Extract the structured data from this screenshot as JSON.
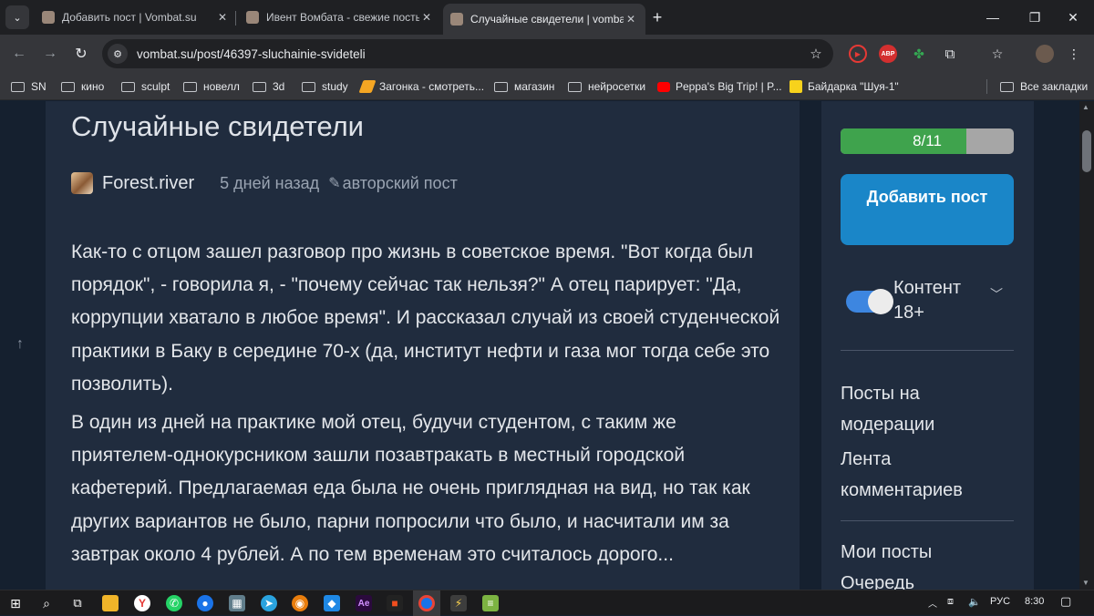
{
  "browser": {
    "tabs": [
      {
        "title": "Добавить пост | Vombat.su",
        "active": false
      },
      {
        "title": "Ивент Вомбата - свежие посты",
        "active": false
      },
      {
        "title": "Случайные свидетели | vombat",
        "active": true
      }
    ],
    "url": "vombat.su/post/46397-sluchainie-svideteli",
    "extension_abp_label": "ABP",
    "bookmarks": [
      {
        "label": "SN",
        "type": "folder"
      },
      {
        "label": "кино",
        "type": "folder"
      },
      {
        "label": "sculpt",
        "type": "folder"
      },
      {
        "label": "новелл",
        "type": "folder"
      },
      {
        "label": "3d",
        "type": "folder"
      },
      {
        "label": "study",
        "type": "folder"
      },
      {
        "label": "Загонка - смотреть...",
        "type": "site",
        "color": "#f5a623"
      },
      {
        "label": "магазин",
        "type": "folder"
      },
      {
        "label": "нейросетки",
        "type": "folder"
      },
      {
        "label": "Peppa's Big Trip! | P...",
        "type": "site",
        "color": "#ff0000"
      },
      {
        "label": "Байдарка \"Шуя-1\"",
        "type": "site",
        "color": "#f7d21c"
      }
    ],
    "all_bookmarks_label": "Все закладки"
  },
  "post": {
    "title": "Случайные свидетели",
    "author": "Forest.river",
    "time": "5 дней назад",
    "tag": "авторский пост",
    "paragraphs": [
      "Как-то с отцом зашел разговор про жизнь в советское время. \"Вот когда был порядок\", - говорила я, - \"почему сейчас так нельзя?\" А отец парирует: \"Да, коррупции хватало в любое время\". И рассказал случай из своей студенческой практики в Баку в середине 70-х (да, институт нефти и газа мог тогда себе это позволить).",
      "В один из дней на практике мой отец, будучи студентом, с таким же приятелем-однокурсником зашли позавтракать в местный городской кафетерий. Предлагаемая еда была не очень приглядная на вид, но так как других вариантов не было, парни попросили что было, и насчитали им за завтрак около 4 рублей. А по тем временам это считалось дорого..."
    ]
  },
  "sidebar": {
    "progress_label": "8/11",
    "progress_fraction": 0.727,
    "add_post_label": "Добавить пост",
    "content_toggle_label": "Контент 18+",
    "content_toggle_on": true,
    "links_group1": [
      "Посты на модерации",
      "Лента комментариев"
    ],
    "links_group2": [
      "Мои посты",
      "Очередь"
    ]
  },
  "taskbar": {
    "language": "РУС",
    "time": "8:30"
  },
  "colors": {
    "page_bg": "#15202f",
    "card_bg": "#202c3e",
    "accent_button": "#1a86c8",
    "progress_fill": "#3fa34d",
    "toggle_on": "#3d86e0"
  }
}
